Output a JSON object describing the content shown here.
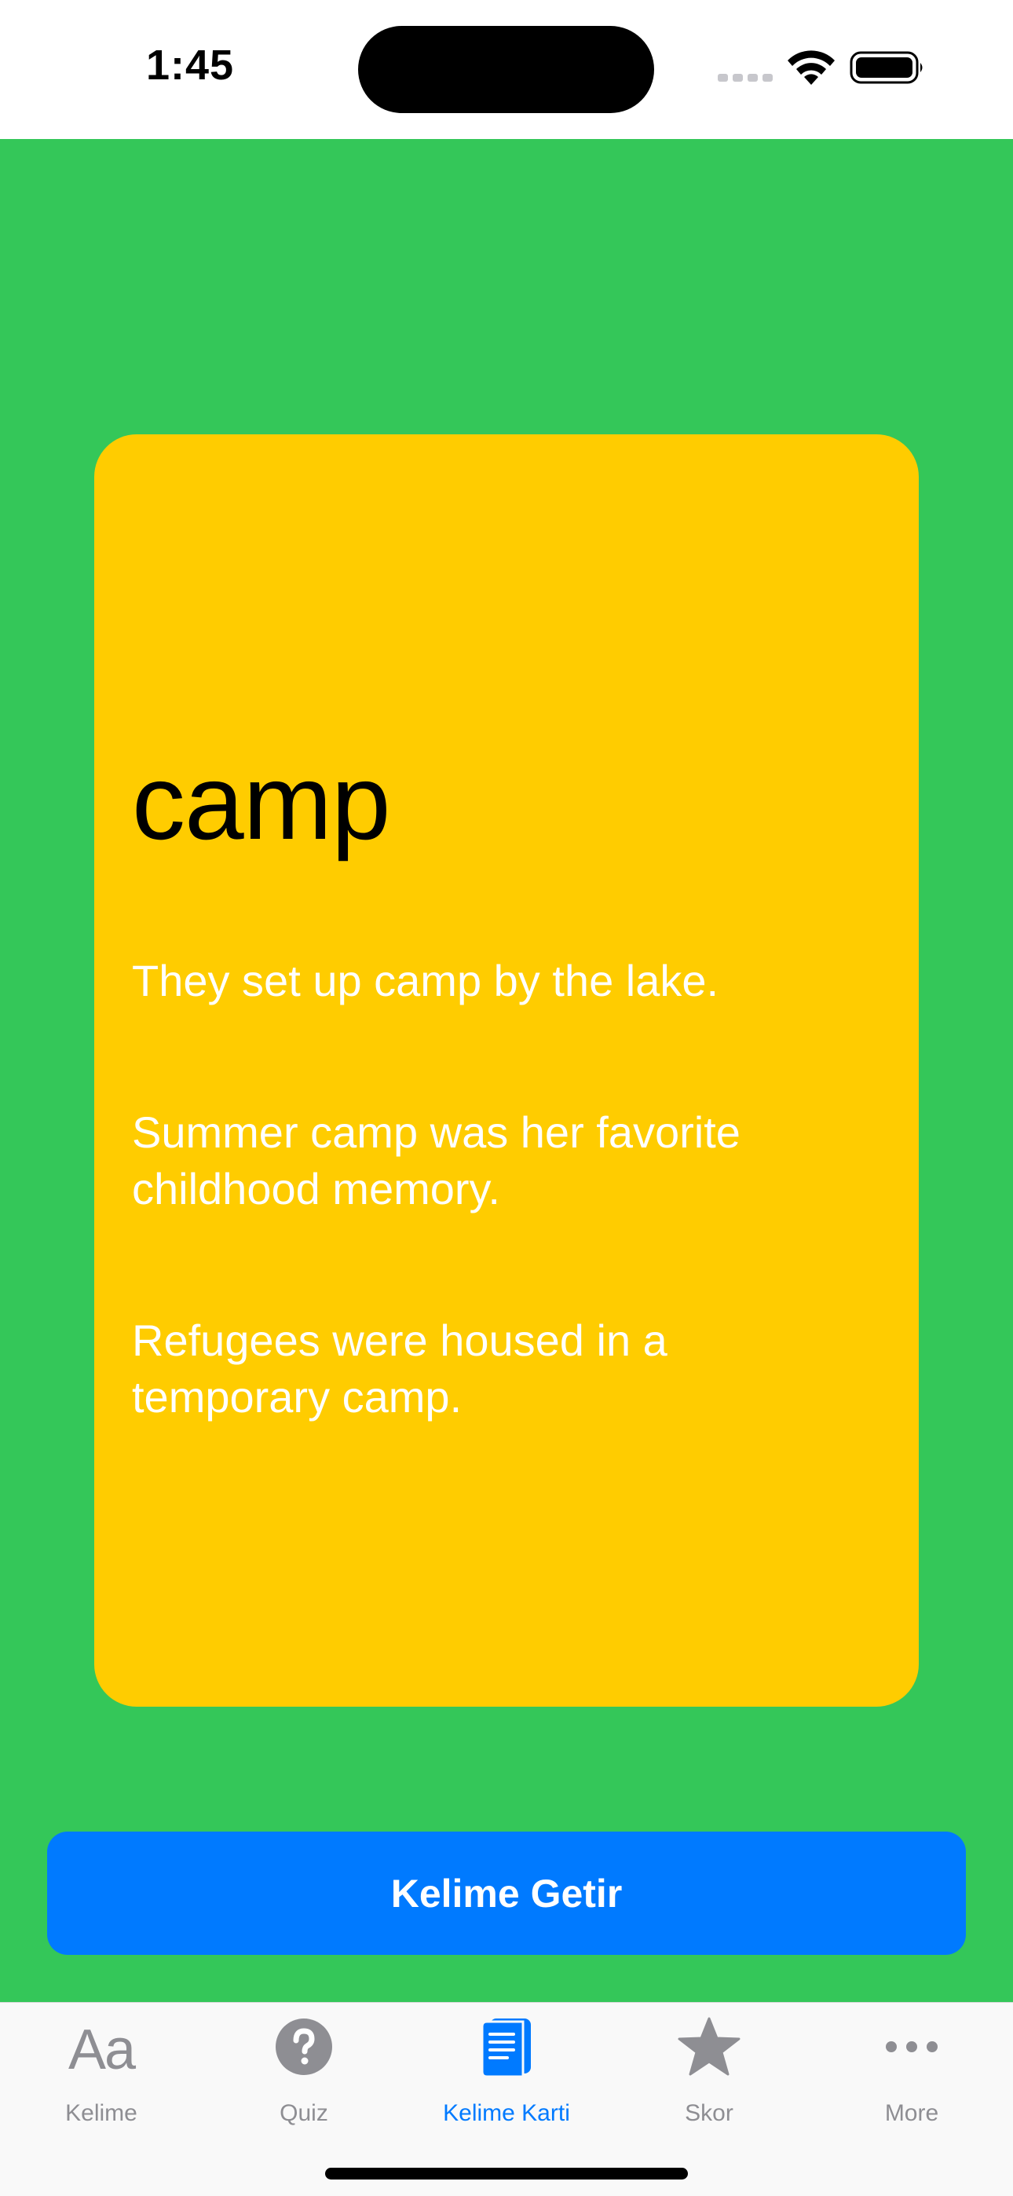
{
  "status_bar": {
    "time": "1:45"
  },
  "card": {
    "word": "camp",
    "examples": [
      "They set up camp by the lake.",
      "Summer camp was her favorite childhood memory.",
      "Refugees were housed in a temporary camp."
    ]
  },
  "button": {
    "label": "Kelime Getir"
  },
  "tabs": [
    {
      "label": "Kelime",
      "icon": "text-aa-icon",
      "active": false,
      "glyph": "Aa"
    },
    {
      "label": "Quiz",
      "icon": "question-circle-icon",
      "active": false
    },
    {
      "label": "Kelime Karti",
      "icon": "book-icon",
      "active": true
    },
    {
      "label": "Skor",
      "icon": "star-icon",
      "active": false
    },
    {
      "label": "More",
      "icon": "more-dots-icon",
      "active": false
    }
  ],
  "colors": {
    "background": "#34c759",
    "card": "#ffcc00",
    "accent": "#007aff",
    "tab_inactive": "#8e8e93"
  }
}
